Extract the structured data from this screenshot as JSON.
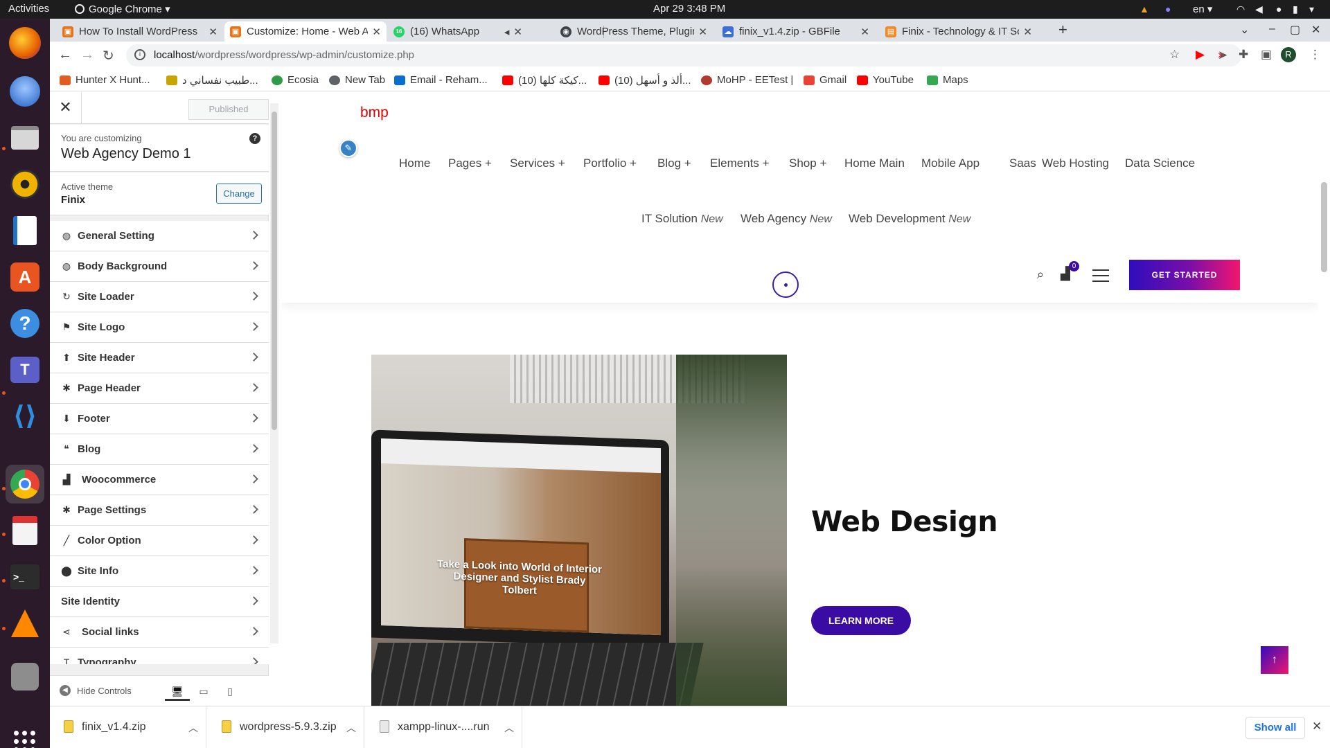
{
  "system": {
    "activities": "Activities",
    "app_menu": "Google Chrome",
    "clock": "Apr 29  3:48 PM",
    "language": "en"
  },
  "tabs": [
    {
      "title": "How To Install WordPress",
      "favicon_color": "#e8741a",
      "favicon": "▣"
    },
    {
      "title": "Customize: Home - Web Agency",
      "favicon_color": "#e8741a",
      "favicon": "▣"
    },
    {
      "title": "(16) WhatsApp",
      "favicon_color": "#25d366",
      "favicon": "16"
    },
    {
      "title": "WordPress Theme, Plugins",
      "favicon_color": "#3c434a",
      "favicon": "◉"
    },
    {
      "title": "finix_v1.4.zip - GBFile",
      "favicon_color": "#3b6fd6",
      "favicon": "☁"
    },
    {
      "title": "Finix - Technology & IT Solutions",
      "favicon_color": "#f08a24",
      "favicon": "▤"
    }
  ],
  "address": {
    "host": "localhost",
    "path": "/wordpress/wordpress/wp-admin/customize.php"
  },
  "bookmarks": [
    {
      "label": "Hunter X Hunt...",
      "color": "#e35b1e"
    },
    {
      "label": "طبيب نفساني د...",
      "color": "#c9a400"
    },
    {
      "label": "Ecosia",
      "color": "#2e9b48"
    },
    {
      "label": "New Tab",
      "color": "#5f6368"
    },
    {
      "label": "Email - Reham...",
      "color": "#0a6ed1"
    },
    {
      "label": "(10) كيكة كلها...",
      "color": "#ff0000"
    },
    {
      "label": "(10) ألذ و أسهل...",
      "color": "#ff0000"
    },
    {
      "label": "MoHP - EETest |",
      "color": "#b03a2e"
    },
    {
      "label": "Gmail",
      "color": "#ea4335"
    },
    {
      "label": "YouTube",
      "color": "#ff0000"
    },
    {
      "label": "Maps",
      "color": "#34a853"
    }
  ],
  "customizer": {
    "published_label": "Published",
    "customizing_label": "You are customizing",
    "site_name": "Web Agency Demo 1",
    "active_theme_label": "Active theme",
    "theme_name": "Finix",
    "change_label": "Change",
    "panels": [
      {
        "label": "General Setting",
        "icon": "globe-icon",
        "glyph": "◍"
      },
      {
        "label": "Body Background",
        "icon": "globe-icon",
        "glyph": "◍"
      },
      {
        "label": "Site Loader",
        "icon": "refresh-icon",
        "glyph": "↻"
      },
      {
        "label": "Site Logo",
        "icon": "flag-icon",
        "glyph": "⚑"
      },
      {
        "label": "Site Header",
        "icon": "arrow-up-icon",
        "glyph": "⬆"
      },
      {
        "label": "Page Header",
        "icon": "gear-icon",
        "glyph": "✱"
      },
      {
        "label": "Footer",
        "icon": "arrow-down-icon",
        "glyph": "⬇"
      },
      {
        "label": "Blog",
        "icon": "quote-icon",
        "glyph": "❝"
      },
      {
        "label": "Woocommerce",
        "icon": "cart-icon",
        "glyph": "🛒"
      },
      {
        "label": "Page Settings",
        "icon": "gear-icon",
        "glyph": "✱"
      },
      {
        "label": "Color Option",
        "icon": "brush-icon",
        "glyph": "╱"
      },
      {
        "label": "Site Info",
        "icon": "map-pin-icon",
        "glyph": "⚲"
      },
      {
        "label": "Site Identity",
        "icon": "",
        "glyph": ""
      },
      {
        "label": "Social links",
        "icon": "share-icon",
        "glyph": "⋖"
      },
      {
        "label": "Typography",
        "icon": "text-icon",
        "glyph": "T"
      }
    ],
    "hide_controls_label": "Hide Controls"
  },
  "site": {
    "logo_text": "bmp",
    "nav_row1": [
      {
        "label": "Home",
        "suffix": ""
      },
      {
        "label": "Pages",
        "suffix": "+"
      },
      {
        "label": "Services",
        "suffix": "+"
      },
      {
        "label": "Portfolio",
        "suffix": "+"
      },
      {
        "label": "Blog",
        "suffix": "+"
      },
      {
        "label": "Elements",
        "suffix": "+"
      },
      {
        "label": "Shop",
        "suffix": "+"
      },
      {
        "label": "Home Main",
        "suffix": ""
      },
      {
        "label": "Mobile App",
        "suffix": ""
      },
      {
        "label": "Saas",
        "suffix": ""
      },
      {
        "label": "Web Hosting",
        "suffix": ""
      },
      {
        "label": "Data Science",
        "suffix": ""
      }
    ],
    "nav_row2": [
      {
        "label": "IT Solution",
        "badge": "New"
      },
      {
        "label": "Web Agency",
        "badge": "New"
      },
      {
        "label": "Web Development",
        "badge": "New"
      }
    ],
    "cart_count": "0",
    "cta_label": "GET STARTED",
    "hero_title": "Web Design",
    "hero_button": "LEARN MORE",
    "hero_screen_headline": "Take a Look into World of Interior Designer and Stylist Brady Tolbert",
    "accent_color": "#3a0ca3",
    "gradient_end": "#f2166e"
  },
  "downloads": {
    "items": [
      {
        "name": "finix_v1.4.zip"
      },
      {
        "name": "wordpress-5.9.3.zip"
      },
      {
        "name": "xampp-linux-....run"
      }
    ],
    "show_all_label": "Show all"
  }
}
